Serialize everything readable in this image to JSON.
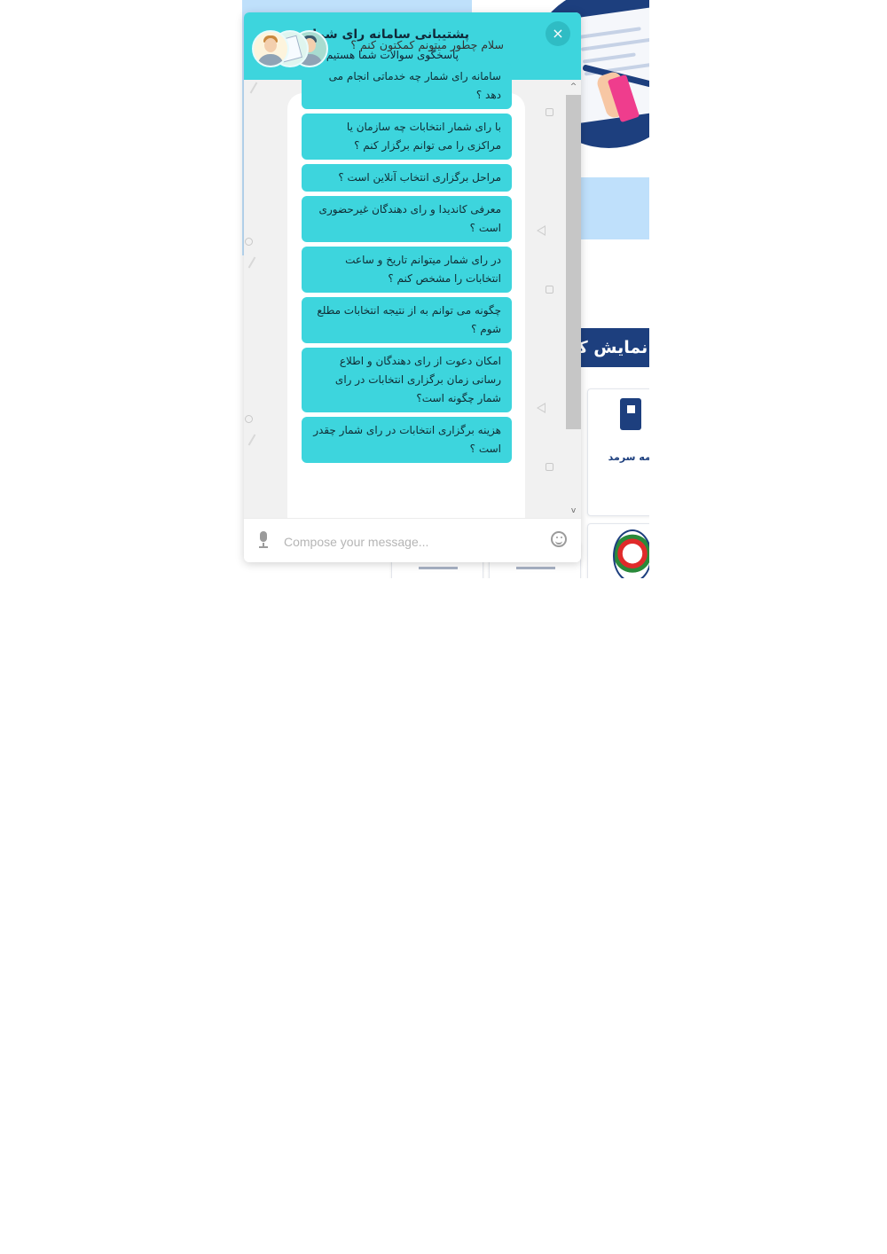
{
  "chat": {
    "title": "پشتیبانی سامانه رای شمار",
    "subtitle": "پاسخگوی سوالات شما هستیم",
    "close_label": "×",
    "greeting": "سلام چطور میتونم کمکتون کنم ؟",
    "options": [
      "سامانه رای شمار چه خدماتی انجام می دهد ؟",
      "با رای شمار انتخابات چه سازمان یا مراکزی را می توانم برگزار کنم ؟",
      "مراحل برگزاری انتخاب آنلاین است ؟",
      "معرفی کاندیدا و رای دهندگان غیرحضوری است ؟",
      "در رای شمار میتوانم تاریخ و ساعت انتخابات را مشخص کنم ؟",
      "چگونه می توانم به از نتیجه انتخابات مطلع شوم ؟",
      "امکان دعوت از رای دهندگان و اطلاع رسانی زمان برگزاری انتخابات در رای شمار چگونه است؟",
      "هزینه برگزاری انتخابات در رای شمار چقدر است ؟"
    ],
    "composer": {
      "placeholder": "Compose your message...",
      "mic_icon": "microphone-icon",
      "emoji_icon": "smiley-face-icon"
    },
    "scroll_up_glyph": "^",
    "scroll_down_glyph": "v"
  },
  "background": {
    "show_all_button": "نمایش کل",
    "partner_logo_text": "بیمه سرمد",
    "illustration": "hand-writing-on-document-illustration"
  },
  "colors": {
    "header_bg": "#3dd5dd",
    "option_bg": "#3dd5dd",
    "close_button_bg": "#2fbcc4",
    "brand_dark_blue": "#1d3f7e",
    "light_blue_panel": "#bfe0fb"
  }
}
